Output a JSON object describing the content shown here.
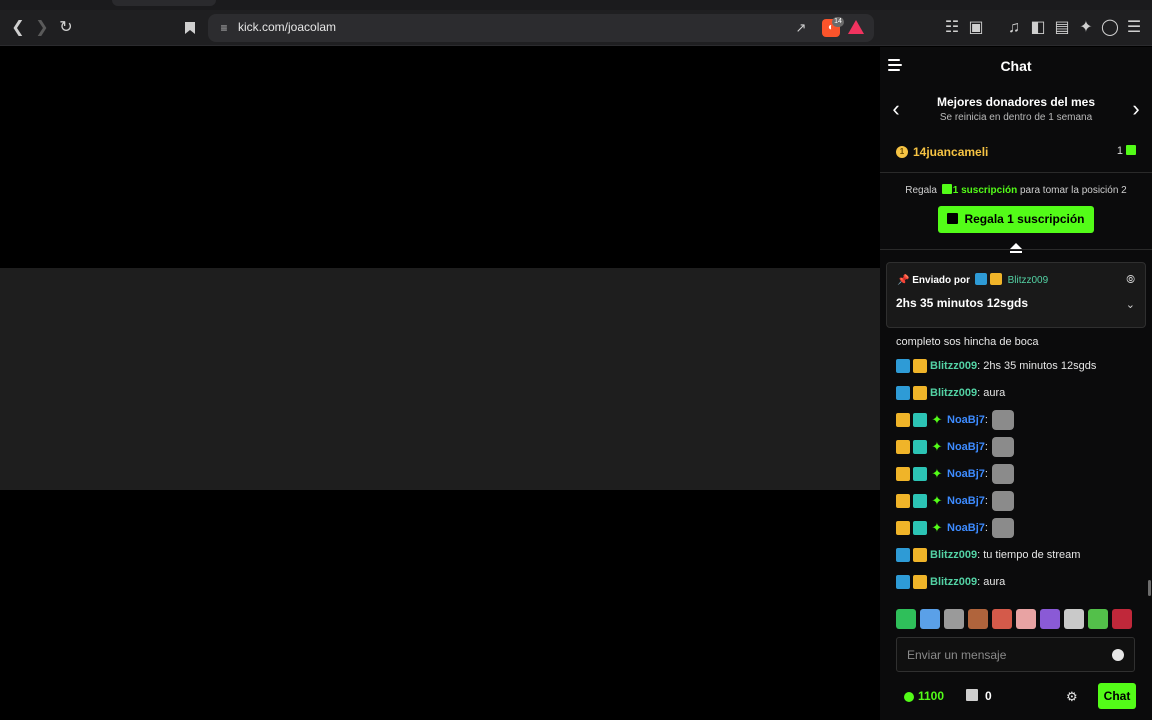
{
  "browser": {
    "url": "kick.com/joacolam",
    "shields_count": "14"
  },
  "chat": {
    "title": "Chat",
    "donors": {
      "title": "Mejores donadores del mes",
      "subtitle": "Se reinicia en dentro de 1 semana",
      "top_name": "14juancameli",
      "top_count": "1"
    },
    "gift": {
      "prefix": "Regala",
      "highlight": "1 suscripción",
      "suffix": "para tomar la posición 2",
      "button_label": "Regala 1 suscripción"
    },
    "pinned": {
      "label": "Enviado por",
      "author": "Blitzz009",
      "text": "2hs 35 minutos 12sgds"
    },
    "messages": [
      {
        "text": "completo sos hincha de boca"
      },
      {
        "user": "Blitzz009",
        "sep": ":",
        "text": "2hs 35 minutos 12sgds"
      },
      {
        "user": "Blitzz009",
        "sep": ":",
        "text": "aura"
      },
      {
        "user": "NoaBj7",
        "sep": ":"
      },
      {
        "user": "NoaBj7",
        "sep": ":"
      },
      {
        "user": "NoaBj7",
        "sep": ":"
      },
      {
        "user": "NoaBj7",
        "sep": ":"
      },
      {
        "user": "NoaBj7",
        "sep": ":"
      },
      {
        "user": "Blitzz009",
        "sep": ":",
        "text": "tu tiempo de stream"
      },
      {
        "user": "Blitzz009",
        "sep": ":",
        "text": "aura"
      }
    ],
    "emote_colors": [
      "#2fbf5a",
      "#5aa0e8",
      "#9a9a9a",
      "#b0643c",
      "#d45a4a",
      "#e8a3a3",
      "#8a5ad6",
      "#c9c9c9",
      "#53c04a",
      "#c0283a"
    ],
    "input_placeholder": "Enviar un mensaje",
    "points": "1100",
    "store_count": "0",
    "send_label": "Chat"
  },
  "colors": {
    "accent": "#53fc18",
    "gold": "#f6c343",
    "blitz": "#53d2a4",
    "noa": "#3d8bff"
  }
}
